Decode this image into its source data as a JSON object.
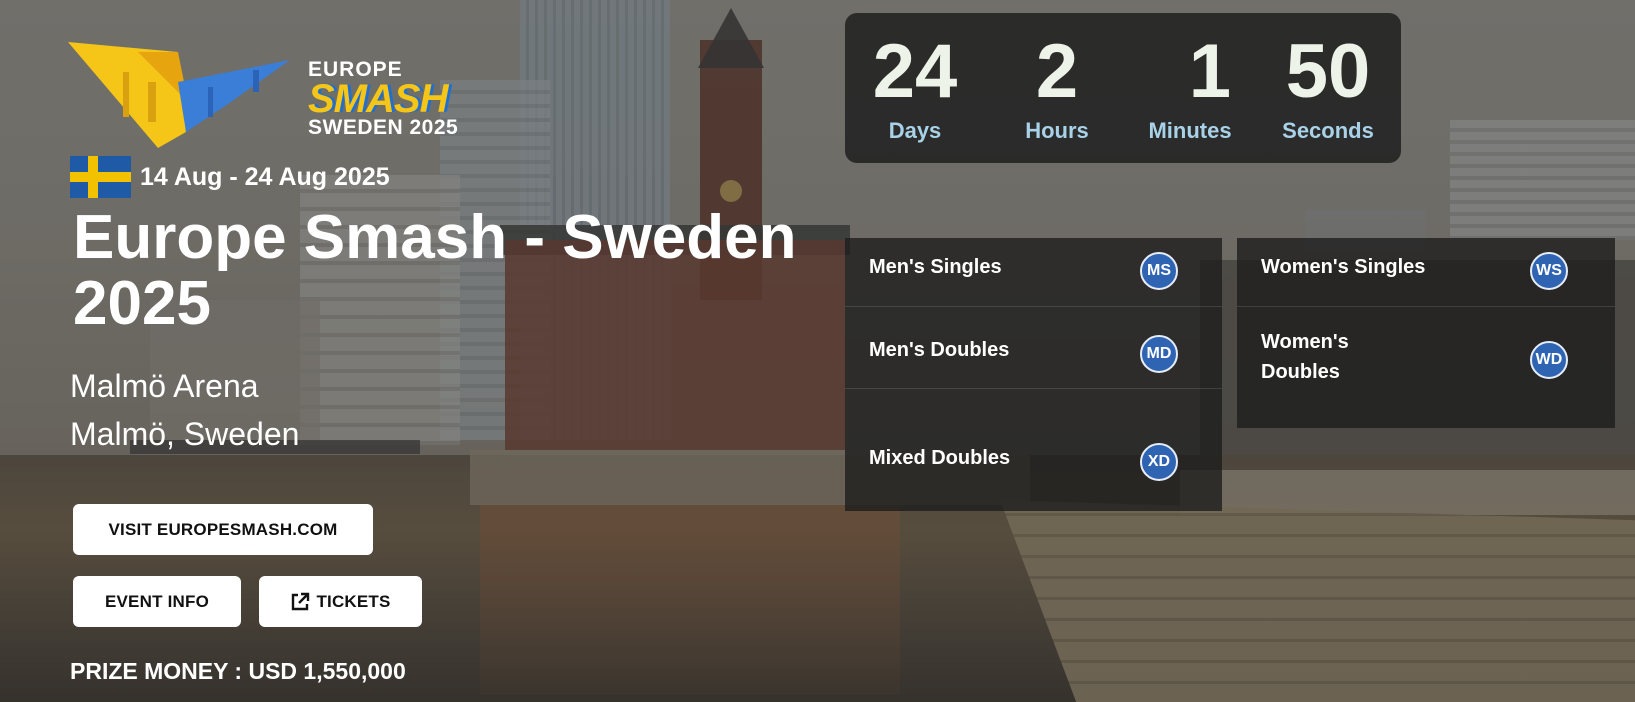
{
  "logo": {
    "line1": "EUROPE",
    "line2": "SMASH",
    "line3": "SWEDEN 2025"
  },
  "event": {
    "dates": "14 Aug - 24 Aug 2025",
    "title": "Europe Smash - Sweden 2025",
    "venue": "Malmö Arena",
    "city": "Malmö, Sweden",
    "prize": "PRIZE MONEY : USD 1,550,000",
    "flag_icon": "sweden-flag-icon"
  },
  "buttons": {
    "visit": "VISIT EUROPESMASH.COM",
    "event_info": "EVENT INFO",
    "tickets": "TICKETS"
  },
  "countdown": {
    "days": "24",
    "days_label": "Days",
    "hours": "2",
    "hours_label": "Hours",
    "minutes": "1",
    "minutes_label": "Minutes",
    "seconds": "50",
    "seconds_label": "Seconds"
  },
  "events": {
    "left": [
      {
        "label": "Men's Singles",
        "badge": "MS"
      },
      {
        "label": "Men's Doubles",
        "badge": "MD"
      },
      {
        "label": "Mixed Doubles",
        "badge": "XD"
      }
    ],
    "right": [
      {
        "label": "Women's Singles",
        "badge": "WS"
      },
      {
        "label": "Women's Doubles",
        "badge": "WD"
      }
    ]
  },
  "colors": {
    "badge": "#2f64b3",
    "countdown_label": "#a9d2e8",
    "logo_yellow": "#f5c518",
    "logo_blue": "#1f6fd1"
  }
}
